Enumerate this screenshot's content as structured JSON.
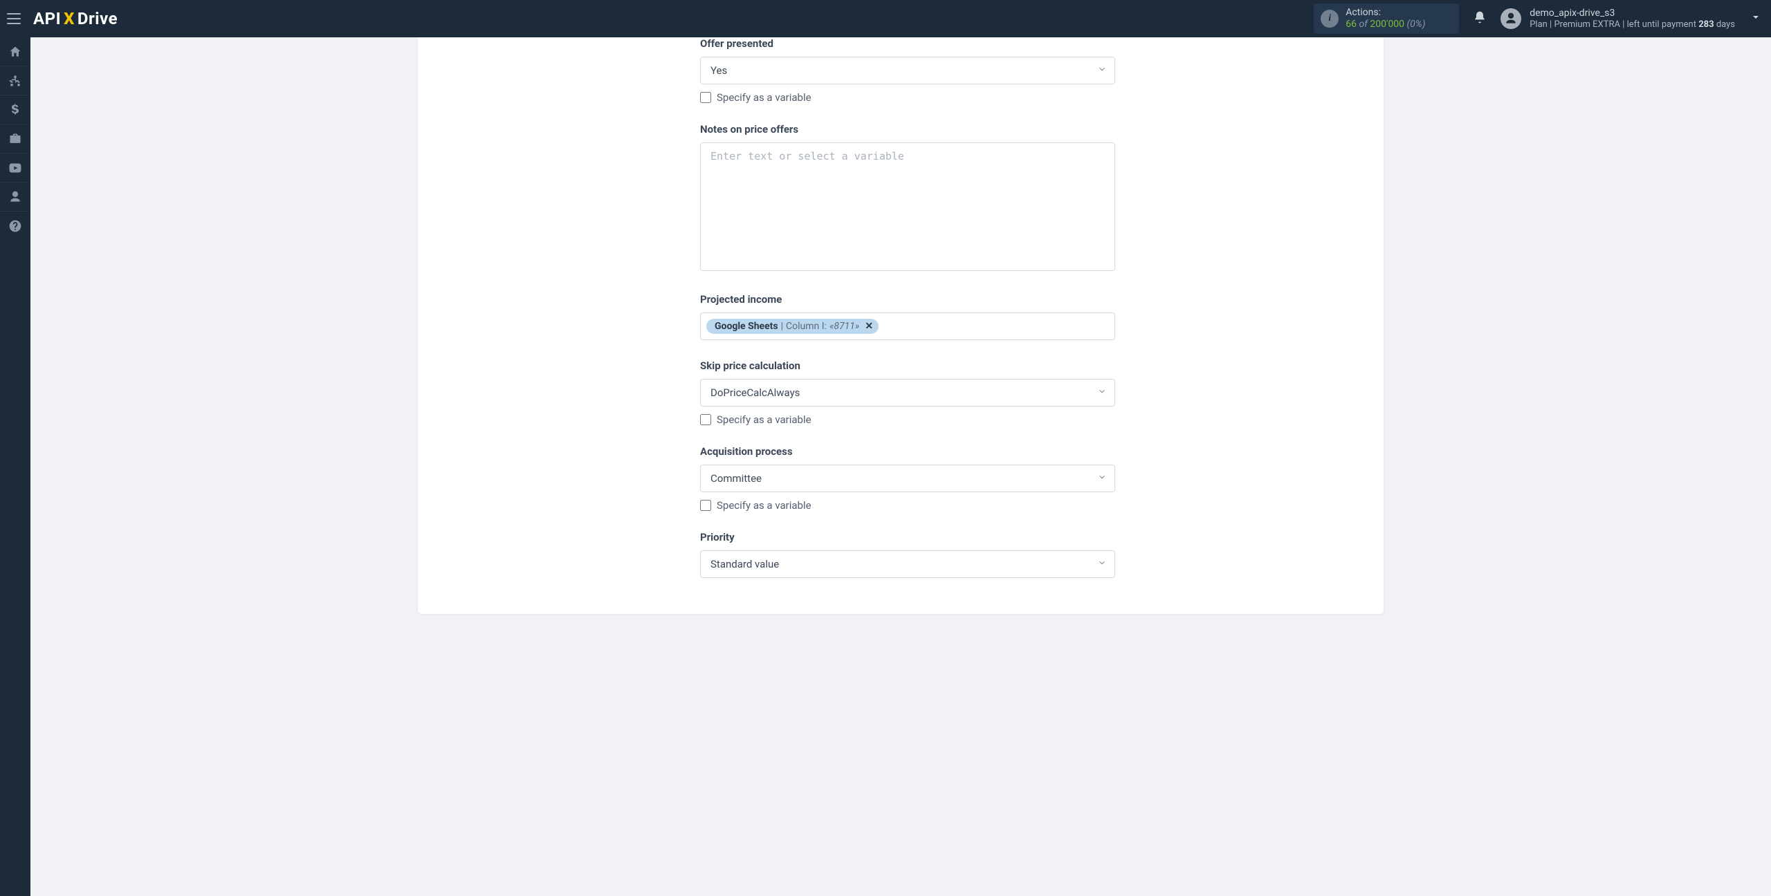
{
  "header": {
    "logo_part1": "API",
    "logo_part2": "X",
    "logo_part3": "Drive",
    "actions": {
      "label": "Actions:",
      "count": "66",
      "of": "of",
      "total": "200'000",
      "pct": "(0%)"
    },
    "user": {
      "name": "demo_apix-drive_s3",
      "plan_prefix": "Plan |",
      "plan_name": "Premium EXTRA",
      "plan_suffix": "| left until payment",
      "days_num": "283",
      "days_word": "days"
    }
  },
  "rail": {
    "items": [
      {
        "name": "home-icon"
      },
      {
        "name": "sitemap-icon"
      },
      {
        "name": "dollar-icon"
      },
      {
        "name": "briefcase-icon"
      },
      {
        "name": "youtube-icon"
      },
      {
        "name": "user-icon"
      },
      {
        "name": "help-icon"
      }
    ]
  },
  "form": {
    "var_checkbox_label": "Specify as a variable",
    "textarea_placeholder": "Enter text or select a variable",
    "offer_presented": {
      "label": "Offer presented",
      "value": "Yes"
    },
    "notes": {
      "label": "Notes on price offers"
    },
    "projected_income": {
      "label": "Projected income",
      "token": {
        "source": "Google Sheets",
        "sep": " | ",
        "column": "Column I:",
        "value": "«8711»"
      }
    },
    "skip_calc": {
      "label": "Skip price calculation",
      "value": "DoPriceCalcAlways"
    },
    "acquisition": {
      "label": "Acquisition process",
      "value": "Committee"
    },
    "priority": {
      "label": "Priority",
      "value": "Standard value"
    }
  }
}
